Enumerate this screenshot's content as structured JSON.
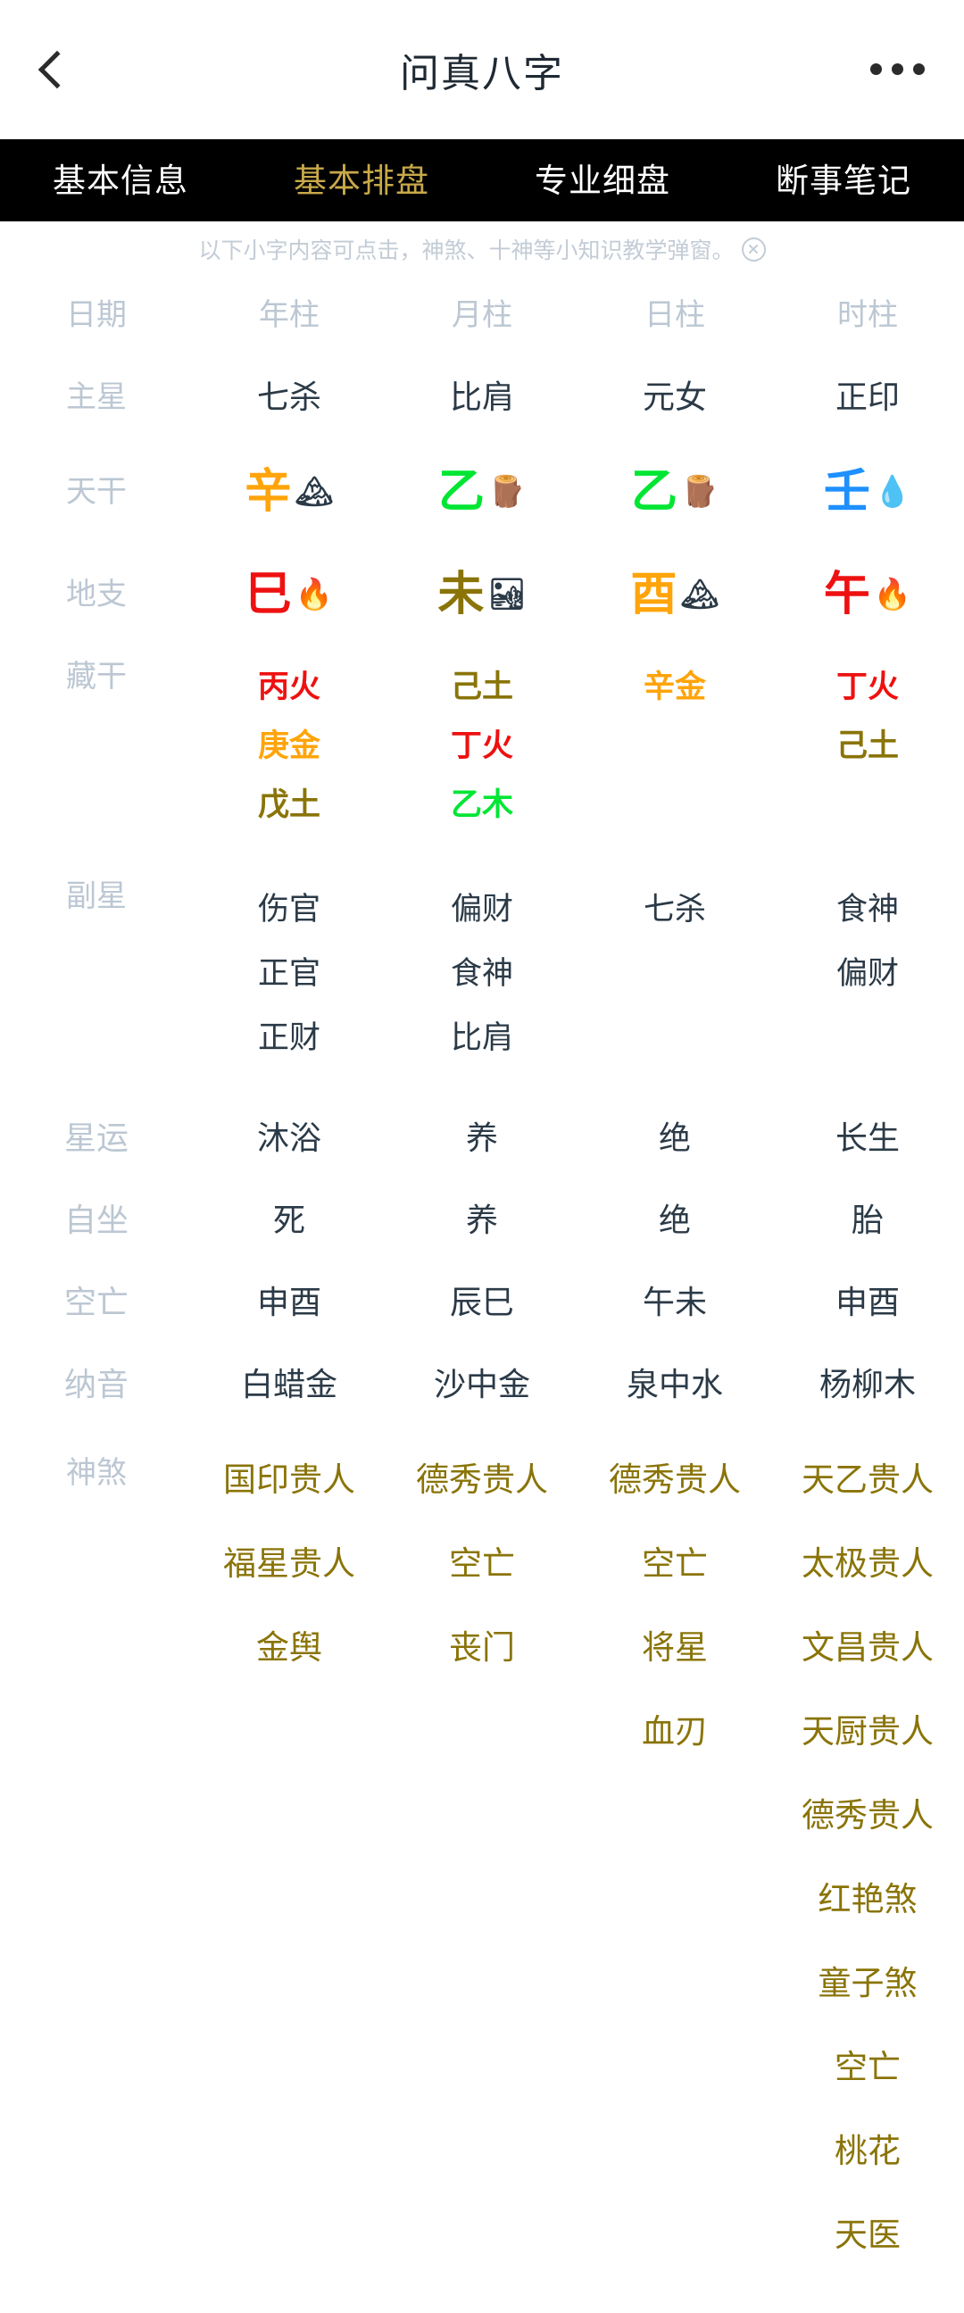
{
  "navbar": {
    "title": "问真八字",
    "back_icon": "chevron-left-icon",
    "more_icon": "more-horizontal-icon"
  },
  "tabs": [
    {
      "label": "基本信息",
      "active": false
    },
    {
      "label": "基本排盘",
      "active": true
    },
    {
      "label": "专业细盘",
      "active": false
    },
    {
      "label": "断事笔记",
      "active": false
    }
  ],
  "notice": {
    "text": "以下小字内容可点击，神煞、十神等小知识教学弹窗。",
    "close_icon": "close-circle-icon"
  },
  "colors": {
    "tab_active": "#c8a94a",
    "label": "#bcc7d3",
    "text": "#2b3a47",
    "fire": "#ee1111",
    "wood": "#00e633",
    "metal": "#ffa40a",
    "earth": "#8a7408",
    "water": "#1e90ff",
    "shensha": "#8a7408"
  },
  "table": {
    "header": [
      "日期",
      "年柱",
      "月柱",
      "日柱",
      "时柱"
    ],
    "rows": {
      "main_star": {
        "label": "主星",
        "values": [
          "七杀",
          "比肩",
          "元女",
          "正印"
        ]
      },
      "heavenly_stem": {
        "label": "天干",
        "values": [
          {
            "char": "辛",
            "element": "metal",
            "emoji": "🏔",
            "color": "#ffa40a"
          },
          {
            "char": "乙",
            "element": "wood",
            "emoji": "🪵",
            "color": "#00e633"
          },
          {
            "char": "乙",
            "element": "wood",
            "emoji": "🪵",
            "color": "#00e633"
          },
          {
            "char": "壬",
            "element": "water",
            "emoji": "💧",
            "color": "#1e90ff"
          }
        ]
      },
      "earthly_branch": {
        "label": "地支",
        "values": [
          {
            "char": "巳",
            "element": "fire",
            "emoji": "🔥",
            "color": "#ee1111"
          },
          {
            "char": "未",
            "element": "earth",
            "emoji": "🏜",
            "color": "#8a7408"
          },
          {
            "char": "酉",
            "element": "metal",
            "emoji": "🏔",
            "color": "#ffa40a"
          },
          {
            "char": "午",
            "element": "fire",
            "emoji": "🔥",
            "color": "#ee1111"
          }
        ]
      },
      "hidden_stems": {
        "label": "藏干",
        "columns": [
          [
            {
              "text": "丙火",
              "color": "#ee1111"
            },
            {
              "text": "庚金",
              "color": "#ffa40a"
            },
            {
              "text": "戊土",
              "color": "#8a7408"
            }
          ],
          [
            {
              "text": "己土",
              "color": "#8a7408"
            },
            {
              "text": "丁火",
              "color": "#ee1111"
            },
            {
              "text": "乙木",
              "color": "#00e633"
            }
          ],
          [
            {
              "text": "辛金",
              "color": "#ffa40a"
            }
          ],
          [
            {
              "text": "丁火",
              "color": "#ee1111"
            },
            {
              "text": "己土",
              "color": "#8a7408"
            }
          ]
        ]
      },
      "sub_star": {
        "label": "副星",
        "columns": [
          [
            "伤官",
            "正官",
            "正财"
          ],
          [
            "偏财",
            "食神",
            "比肩"
          ],
          [
            "七杀"
          ],
          [
            "食神",
            "偏财"
          ]
        ]
      },
      "star_fortune": {
        "label": "星运",
        "values": [
          "沐浴",
          "养",
          "绝",
          "长生"
        ]
      },
      "self_sitting": {
        "label": "自坐",
        "values": [
          "死",
          "养",
          "绝",
          "胎"
        ]
      },
      "void": {
        "label": "空亡",
        "values": [
          "申酉",
          "辰巳",
          "午未",
          "申酉"
        ]
      },
      "nayin": {
        "label": "纳音",
        "values": [
          "白蜡金",
          "沙中金",
          "泉中水",
          "杨柳木"
        ]
      },
      "shensha": {
        "label": "神煞",
        "columns": [
          [
            "国印贵人",
            "福星贵人",
            "金舆"
          ],
          [
            "德秀贵人",
            "空亡",
            "丧门"
          ],
          [
            "德秀贵人",
            "空亡",
            "将星",
            "血刃"
          ],
          [
            "天乙贵人",
            "太极贵人",
            "文昌贵人",
            "天厨贵人",
            "德秀贵人",
            "红艳煞",
            "童子煞",
            "空亡",
            "桃花",
            "天医"
          ]
        ]
      }
    }
  }
}
